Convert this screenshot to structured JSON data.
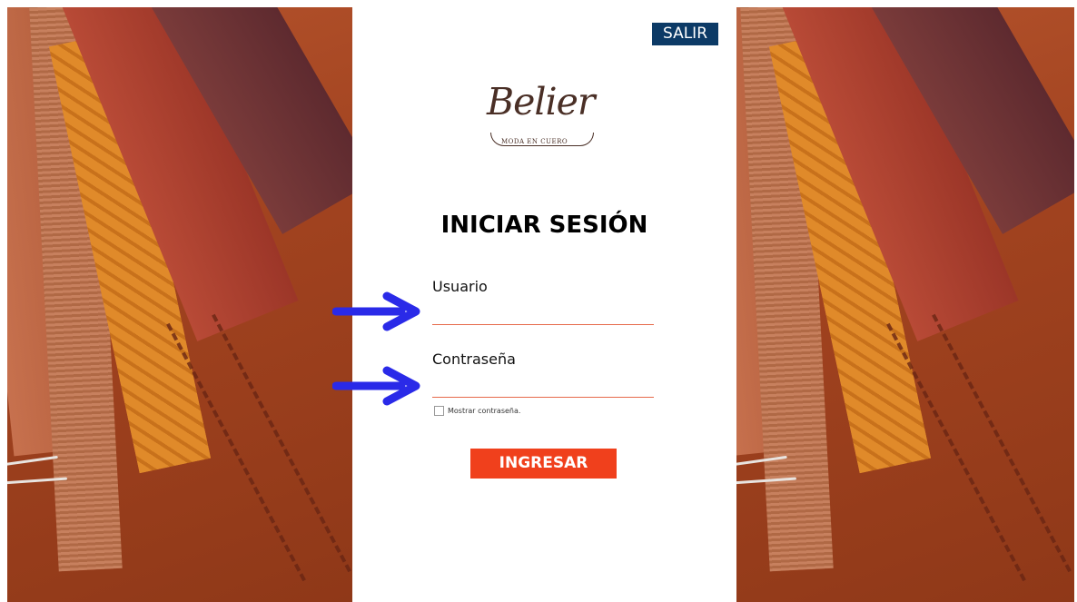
{
  "header": {
    "exit_label": "SALIR",
    "exit_color": "#0c3a66"
  },
  "brand": {
    "name": "Belier",
    "tagline": "MODA EN CUERO"
  },
  "form": {
    "title": "INICIAR SESIÓN",
    "username_label": "Usuario",
    "username_value": "",
    "password_label": "Contraseña",
    "password_value": "",
    "show_password_label": "Mostrar contraseña.",
    "show_password_checked": false,
    "submit_label": "INGRESAR",
    "submit_color": "#f0401c",
    "field_underline_color": "#e66a4b"
  },
  "annotations": {
    "arrow_color": "#2a2ae8",
    "arrow_icon": "arrow-right-icon"
  }
}
